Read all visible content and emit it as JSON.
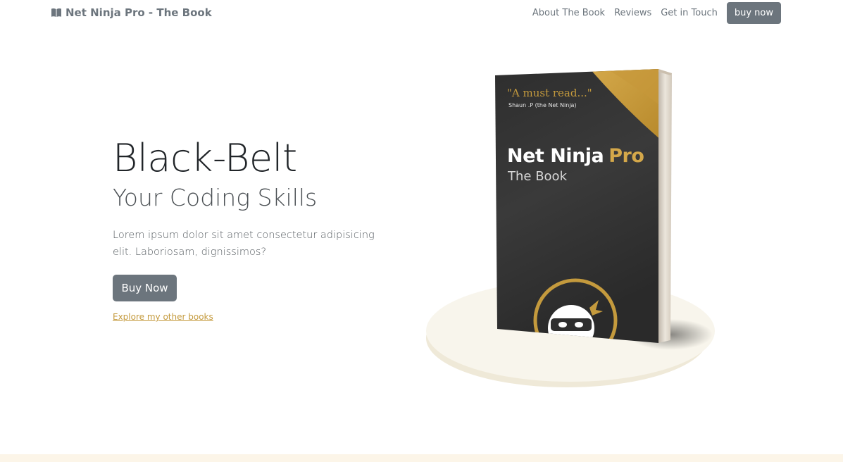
{
  "navbar": {
    "brand_icon": "book-open-icon",
    "brand": "Net Ninja Pro - The Book",
    "links": [
      "About The Book",
      "Reviews",
      "Get in Touch"
    ],
    "cta": "buy now"
  },
  "hero": {
    "title": "Black-Belt",
    "subtitle": "Your Coding Skills",
    "lead": "Lorem ipsum dolor sit amet consectetur adipisicing elit. Laboriosam, dignissimos?",
    "buy_button": "Buy Now",
    "explore_link": "Explore my other books"
  },
  "book": {
    "quote": "\"A must read...\"",
    "quote_author": "Shaun .P (the Net Ninja)",
    "title_main": "Net Ninja",
    "title_accent": "Pro",
    "subtitle": "The Book"
  },
  "colors": {
    "accent_gold": "#c49a3d",
    "button_gray": "#6c757d",
    "cover_dark": "#2f2f2f",
    "pedestal": "#f7f3e7"
  }
}
